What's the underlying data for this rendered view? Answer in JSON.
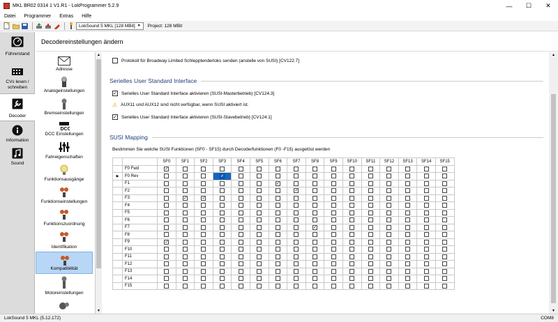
{
  "window": {
    "title": "MKL BR02 0314 1 V1.R1 - LokProgrammer 5.2.9"
  },
  "menu": [
    "Datei",
    "Programmer",
    "Extras",
    "Hilfe"
  ],
  "toolbar": {
    "decoder": "LokSound 5 MKL [128 MBit]",
    "project": "Project:  128 MBit"
  },
  "nav": [
    {
      "label": "Führerstand",
      "icon": "gauge-icon"
    },
    {
      "label": "CVs lesen / schreiben",
      "icon": "chip-icon"
    },
    {
      "label": "Decoder",
      "icon": "wrench-icon",
      "active": true
    },
    {
      "label": "Information",
      "icon": "info-icon"
    },
    {
      "label": "Sound",
      "icon": "music-icon"
    }
  ],
  "header": {
    "title": "Decodereinstellungen ändern"
  },
  "categories": [
    {
      "label": "Adresse",
      "icon": "envelope-icon"
    },
    {
      "label": "Analogeinstellungen",
      "icon": "lamp-icon"
    },
    {
      "label": "Bremseinstellungen",
      "icon": "brake-icon"
    },
    {
      "label": "DCC Einstellungen",
      "icon": "dcc-icon"
    },
    {
      "label": "Fahreigenschaften",
      "icon": "sliders-icon"
    },
    {
      "label": "Funktionsausgänge",
      "icon": "bulb-icon"
    },
    {
      "label": "Funktionseinstellungen",
      "icon": "function-icon"
    },
    {
      "label": "Funktionszuordnung",
      "icon": "mapping-icon"
    },
    {
      "label": "Identifikation",
      "icon": "id-icon"
    },
    {
      "label": "Kompatibilität",
      "icon": "compat-icon",
      "selected": true
    },
    {
      "label": "Motoreinstellungen",
      "icon": "motor-icon"
    },
    {
      "label": "",
      "icon": "gear-icon"
    }
  ],
  "content": {
    "broadway": "Protokoll für Broadway Limited Schlepptenderloks senden (anstelle von SUSI) [CV122.7]",
    "susi_title": "Serielles User Standard Interface",
    "susi_master": "Serielles User Standard Interface aktivieren (SUSI-Masterbetrieb) [CV124.3]",
    "susi_warning": "AUX11 und AUX12 sind nicht verfügbar, wenn SUSI aktiviert ist.",
    "susi_slave": "Serielles User Standard Interface aktivieren (SUSI-Slavebetrieb) [CV124.1]",
    "mapping_title": "SUSI Mapping",
    "mapping_desc": "Bestimmen Sie welche SUSI Funktionen (SF0 - SF15) durch Decoderfunktionen (F0 -F15) ausgelöst werden"
  },
  "mapping": {
    "columns": [
      "SF0",
      "SF1",
      "SF2",
      "SF3",
      "SF4",
      "SF5",
      "SF6",
      "SF7",
      "SF8",
      "SF9",
      "SF10",
      "SF11",
      "SF12",
      "SF13",
      "SF14",
      "SF15"
    ],
    "rows": [
      {
        "label": "F0 Fwd",
        "checked": [
          0
        ]
      },
      {
        "label": "F0 Rev",
        "checked": [
          3
        ],
        "current": true
      },
      {
        "label": "F1",
        "checked": [
          6
        ]
      },
      {
        "label": "F2",
        "checked": [
          7
        ]
      },
      {
        "label": "F3",
        "checked": [
          1,
          2
        ]
      },
      {
        "label": "F4",
        "checked": []
      },
      {
        "label": "F5",
        "checked": []
      },
      {
        "label": "F6",
        "checked": []
      },
      {
        "label": "F7",
        "checked": [
          8
        ]
      },
      {
        "label": "F8",
        "checked": []
      },
      {
        "label": "F9",
        "checked": [
          0
        ]
      },
      {
        "label": "F10",
        "checked": []
      },
      {
        "label": "F11",
        "checked": []
      },
      {
        "label": "F12",
        "checked": []
      },
      {
        "label": "F13",
        "checked": []
      },
      {
        "label": "F14",
        "checked": []
      },
      {
        "label": "F15",
        "checked": []
      }
    ]
  },
  "status": {
    "left": "LokSound 5 MKL (5.12.172)",
    "right": "COM8"
  }
}
